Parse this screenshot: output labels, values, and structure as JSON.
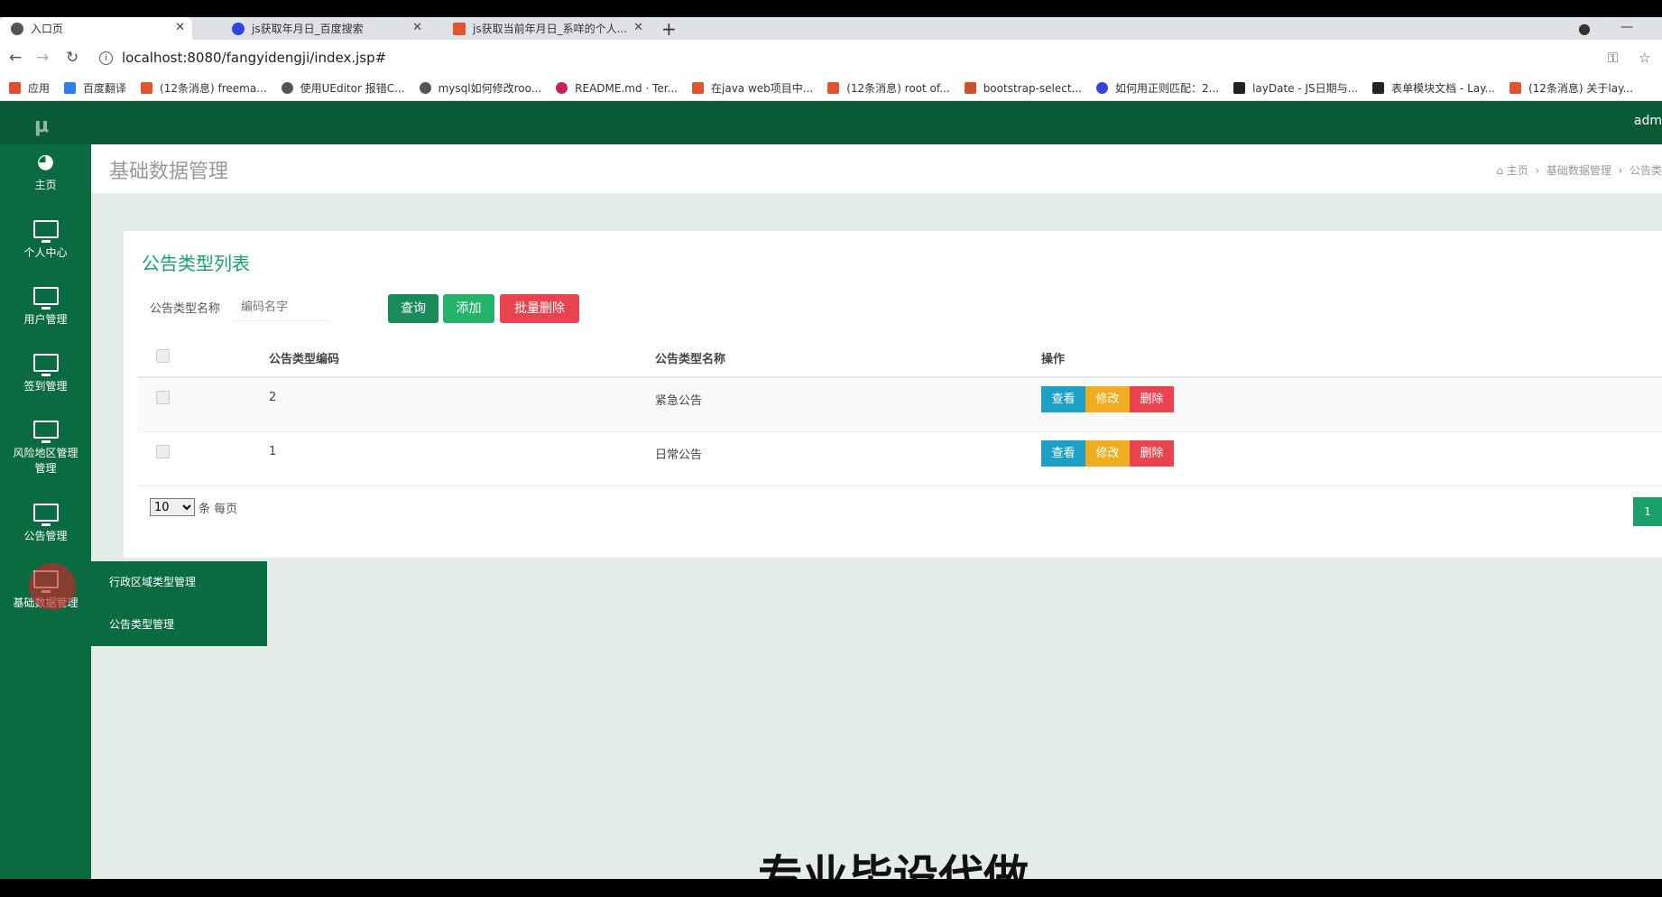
{
  "browser": {
    "tabs": [
      {
        "label": "入口页",
        "icon": "globe-icon",
        "color": "#555555"
      },
      {
        "label": "js获取年月日_百度搜索",
        "icon": "paw-icon",
        "color": "#3245df"
      },
      {
        "label": "js获取当前年月日_系咩的个人...",
        "icon": "csdn-icon",
        "color": "#e3532e"
      }
    ],
    "new_tab": "+",
    "url": "localhost:8080/fangyidengji/index.jsp#",
    "bookmarks": [
      {
        "label": "应用",
        "color": "#e04d31"
      },
      {
        "label": "百度翻译",
        "color": "#2d7ff0"
      },
      {
        "label": "(12条消息) freema...",
        "color": "#e3532e"
      },
      {
        "label": "使用UEditor 报错C...",
        "color": "#555555"
      },
      {
        "label": "mysql如何修改roo...",
        "color": "#555555"
      },
      {
        "label": "README.md · Ter...",
        "color": "#c7254e"
      },
      {
        "label": "在java web项目中...",
        "color": "#e3532e"
      },
      {
        "label": "(12条消息) root of...",
        "color": "#e3532e"
      },
      {
        "label": "bootstrap-select...",
        "color": "#d0502e"
      },
      {
        "label": "如何用正则匹配：2...",
        "color": "#3245df"
      },
      {
        "label": "layDate - JS日期与...",
        "color": "#222222"
      },
      {
        "label": "表单模块文档 - Lay...",
        "color": "#222222"
      },
      {
        "label": "(12条消息) 关于lay...",
        "color": "#e3532e"
      }
    ]
  },
  "app": {
    "logo": "μ",
    "user": "adm",
    "sidebar": [
      {
        "label": "主页",
        "icon": "dashboard-icon"
      },
      {
        "label": "个人中心",
        "icon": "monitor-icon"
      },
      {
        "label": "用户管理",
        "icon": "monitor-icon"
      },
      {
        "label": "签到管理",
        "icon": "monitor-icon"
      },
      {
        "label": "风险地区管理",
        "label2": "管理",
        "icon": "monitor-icon"
      },
      {
        "label": "公告管理",
        "icon": "monitor-icon"
      },
      {
        "label": "基础数据管理",
        "icon": "monitor-icon"
      }
    ],
    "submenu": [
      "行政区域类型管理",
      "公告类型管理"
    ],
    "page_title": "基础数据管理",
    "breadcrumb": {
      "home": "主页",
      "section": "基础数据管理",
      "current": "公告类"
    },
    "card_title": "公告类型列表",
    "search": {
      "label": "公告类型名称",
      "placeholder": "编码名字",
      "query_button": "查询",
      "add_button": "添加",
      "batch_delete_button": "批量删除"
    },
    "table": {
      "headers": [
        "公告类型编码",
        "公告类型名称",
        "操作"
      ],
      "rows": [
        {
          "code": "2",
          "name": "紧急公告"
        },
        {
          "code": "1",
          "name": "日常公告"
        }
      ],
      "actions": {
        "view": "查看",
        "edit": "修改",
        "delete": "删除"
      }
    },
    "pager": {
      "page_size": "10",
      "per_page_text": "条 每页",
      "current_page": "1"
    },
    "colors": {
      "topbar": "#0a5a38",
      "sidebar": "#0b6b40",
      "accent": "#1aa06b",
      "view": "#1ca0c8",
      "edit": "#f0ad1f",
      "delete": "#e8434e"
    }
  },
  "overlay_caption": "专业毕设代做"
}
